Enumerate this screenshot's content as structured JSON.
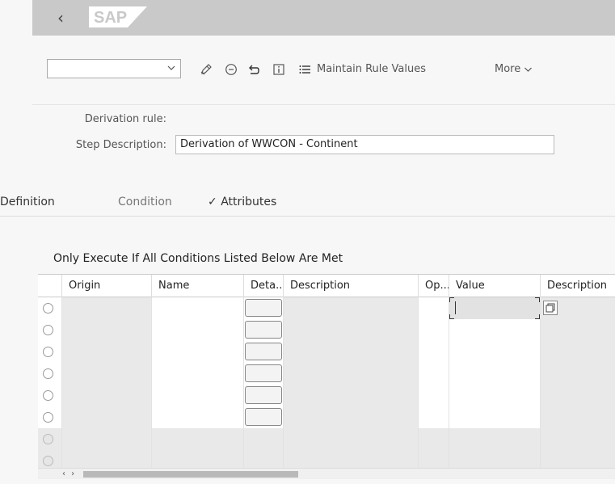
{
  "shell": {
    "back_glyph": "‹",
    "logo_text": "SAP"
  },
  "toolbar": {
    "select_value": "",
    "icons": [
      "edit-icon",
      "remove-icon",
      "undo-icon",
      "info-icon",
      "list-icon"
    ],
    "maintain_label": "Maintain Rule Values",
    "more_label": "More"
  },
  "form": {
    "derivation_label": "Derivation rule:",
    "derivation_value": "",
    "step_label": "Step Description:",
    "step_value": "Derivation of WWCON - Continent"
  },
  "tabs": [
    {
      "label": "Definition"
    },
    {
      "label": "Condition",
      "selected": true
    },
    {
      "label": "Attributes",
      "check": "✓"
    }
  ],
  "table": {
    "title": "Only Execute If All Conditions Listed Below Are Met",
    "columns": [
      "Origin",
      "Name",
      "Deta...",
      "Description",
      "Op...",
      "Value",
      "Description"
    ],
    "editable_rows": 6,
    "disabled_rows": 2
  },
  "colors": {
    "shell_bar": "#c9c9c9",
    "logo_blue": "#ffffff",
    "selected_tab": "#777777"
  }
}
